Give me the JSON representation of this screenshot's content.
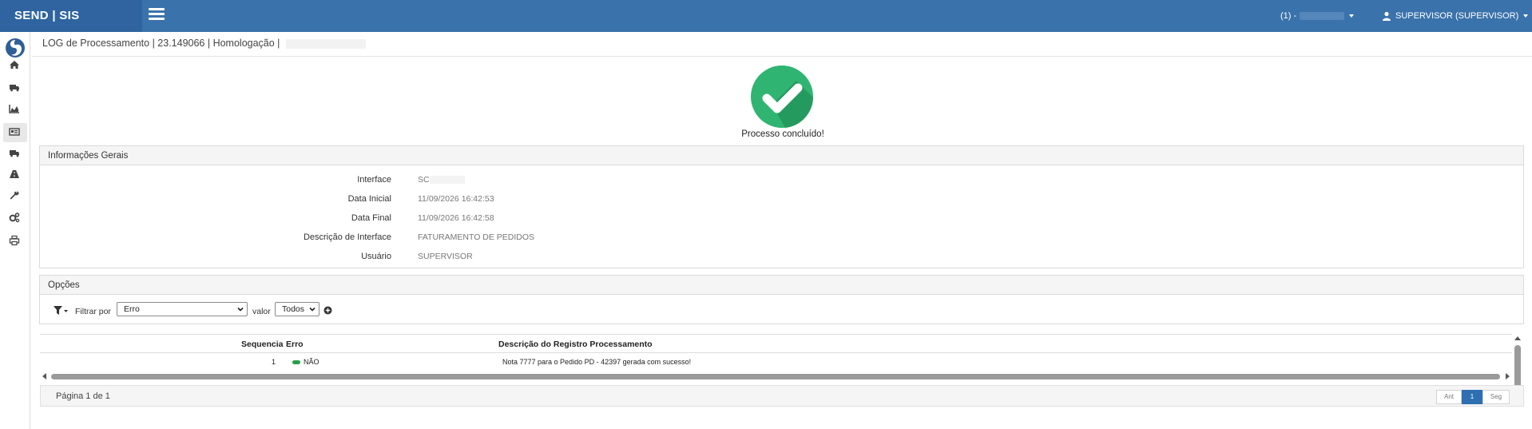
{
  "app": {
    "brand": "SEND | SIS"
  },
  "header": {
    "company_label": "(1) -",
    "user_label": "SUPERVISOR (SUPERVISOR)"
  },
  "sidebar": {
    "icons": [
      "home-icon",
      "truck-icon",
      "area-chart-icon",
      "id-card-icon",
      "truck-icon",
      "road-icon",
      "wrench-icon",
      "gears-icon",
      "print-icon"
    ]
  },
  "breadcrumb": {
    "text": "LOG de Processamento | 23.149066 | Homologação |"
  },
  "status": {
    "text": "Processo concluído!",
    "color": "#2fb571"
  },
  "info": {
    "title": "Informações Gerais",
    "rows": [
      {
        "label": "Interface",
        "value": "SC"
      },
      {
        "label": "Data Inicial",
        "value": "11/09/2026 16:42:53"
      },
      {
        "label": "Data Final",
        "value": "11/09/2026 16:42:58"
      },
      {
        "label": "Descrição de Interface",
        "value": "FATURAMENTO DE PEDIDOS"
      },
      {
        "label": "Usuário",
        "value": "SUPERVISOR"
      }
    ]
  },
  "options": {
    "title": "Opções",
    "filter_label": "Filtrar por",
    "filter_value": "Erro",
    "valor_label": "valor",
    "valor_value": "Todos"
  },
  "grid": {
    "columns": [
      "Sequencia",
      "Erro",
      "Descrição do Registro Processamento"
    ],
    "rows": [
      {
        "sequencia": "1",
        "erro": "NÃO",
        "descricao": "Nota 7777 para o Pedido PD - 42397 gerada com sucesso!"
      }
    ]
  },
  "pager": {
    "text": "Página 1 de 1",
    "prev": "Ant",
    "current": "1",
    "next": "Seg"
  }
}
